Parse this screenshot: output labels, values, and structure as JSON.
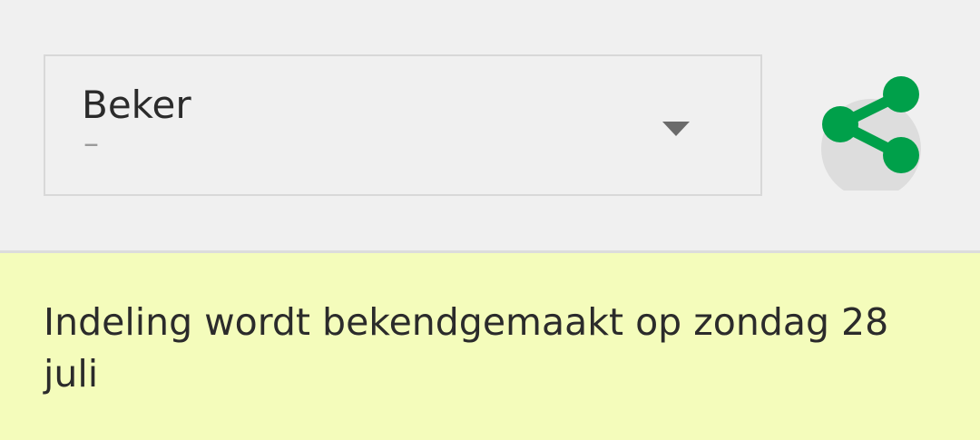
{
  "selector": {
    "label": "Beker",
    "sub_value": "–"
  },
  "share": {
    "icon": "share-icon",
    "color": "#00a04a"
  },
  "banner": {
    "message": "Indeling wordt bekendgemaakt op zondag 28 juli",
    "background": "#f4fcbb"
  }
}
